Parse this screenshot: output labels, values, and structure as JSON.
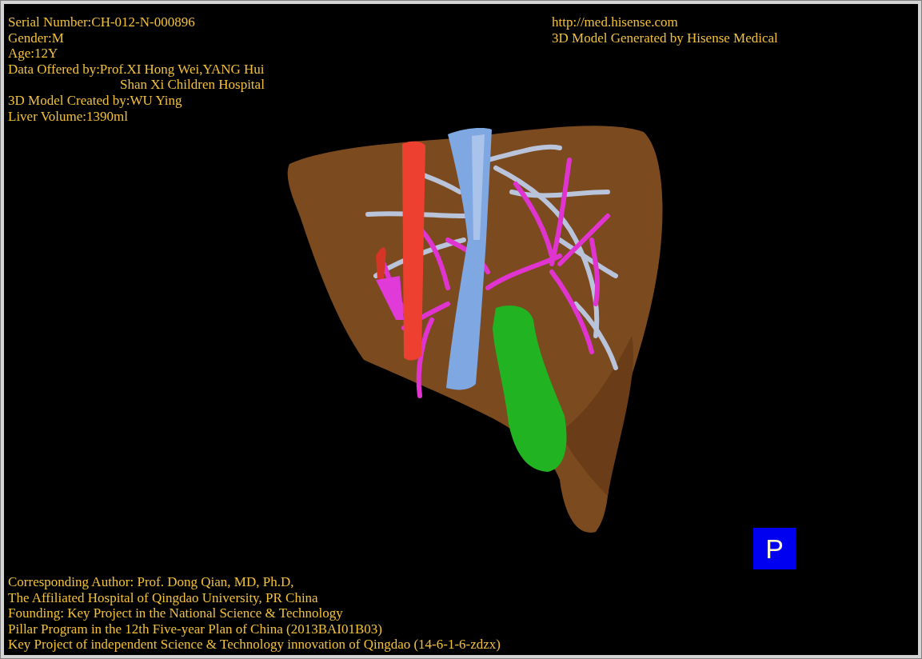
{
  "header_left": [
    {
      "text": "Serial Number:CH-012-N-000896",
      "kind": "line"
    },
    {
      "text": "Gender:M",
      "kind": "line"
    },
    {
      "text": "Age:12Y",
      "kind": "line"
    },
    {
      "text": "Data Offered by:Prof.XI Hong Wei,YANG Hui",
      "kind": "line"
    },
    {
      "text": "Shan Xi Children Hospital",
      "kind": "continuation"
    },
    {
      "text": "3D Model Created by:WU Ying",
      "kind": "line"
    },
    {
      "text": "Liver Volume:1390ml",
      "kind": "line"
    }
  ],
  "header_right": [
    "http://med.hisense.com",
    "3D Model Generated by Hisense Medical"
  ],
  "view_badge": "P",
  "footer": [
    "Corresponding Author: Prof. Dong Qian, MD, Ph.D,",
    "The Affiliated Hospital of Qingdao University, PR China",
    "Founding: Key Project in the National Science & Technology",
    "Pillar Program in the 12th Five-year Plan of China (2013BAI01B03)",
    "Key Project of independent Science & Technology innovation of Qingdao (14-6-1-6-zdzx)"
  ]
}
